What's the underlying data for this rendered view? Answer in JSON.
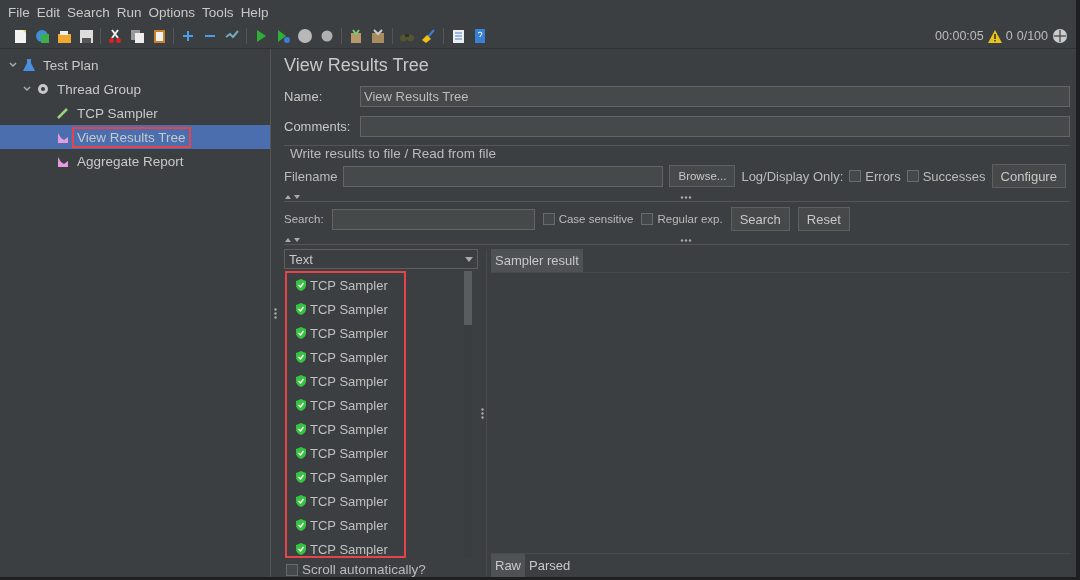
{
  "menu": [
    "File",
    "Edit",
    "Search",
    "Run",
    "Options",
    "Tools",
    "Help"
  ],
  "status": {
    "time": "00:00:05",
    "warnings": "0",
    "threads": "0/100"
  },
  "tree": [
    {
      "label": "Test Plan",
      "kind": "plan",
      "expanded": true,
      "selected": false,
      "highlighted": false,
      "children": [
        {
          "label": "Thread Group",
          "kind": "group",
          "expanded": true,
          "selected": false,
          "highlighted": false,
          "children": [
            {
              "label": "TCP Sampler",
              "kind": "sampler",
              "selected": false,
              "highlighted": false
            },
            {
              "label": "View Results Tree",
              "kind": "listener",
              "selected": true,
              "highlighted": true
            },
            {
              "label": "Aggregate Report",
              "kind": "listener",
              "selected": false,
              "highlighted": false
            }
          ]
        }
      ]
    }
  ],
  "panel": {
    "title": "View Results Tree",
    "name_label": "Name:",
    "name_value": "View Results Tree",
    "comments_label": "Comments:",
    "file_section": {
      "legend": "Write results to file / Read from file",
      "filename_label": "Filename",
      "browse": "Browse...",
      "log_label": "Log/Display Only:",
      "options": [
        {
          "label": "Errors",
          "checked": false
        },
        {
          "label": "Successes",
          "checked": false
        }
      ],
      "configure": "Configure"
    },
    "search": {
      "label": "Search:",
      "options": [
        {
          "label": "Case sensitive",
          "checked": false
        },
        {
          "label": "Regular exp.",
          "checked": false
        }
      ],
      "search_button": "Search",
      "reset_button": "Reset"
    },
    "renderer": "Text",
    "results_highlighted": true,
    "results": [
      {
        "label": "TCP Sampler",
        "success": true
      },
      {
        "label": "TCP Sampler",
        "success": true
      },
      {
        "label": "TCP Sampler",
        "success": true
      },
      {
        "label": "TCP Sampler",
        "success": true
      },
      {
        "label": "TCP Sampler",
        "success": true
      },
      {
        "label": "TCP Sampler",
        "success": true
      },
      {
        "label": "TCP Sampler",
        "success": true
      },
      {
        "label": "TCP Sampler",
        "success": true
      },
      {
        "label": "TCP Sampler",
        "success": true
      },
      {
        "label": "TCP Sampler",
        "success": true
      },
      {
        "label": "TCP Sampler",
        "success": true
      },
      {
        "label": "TCP Sampler",
        "success": true
      }
    ],
    "scroll_auto": {
      "label": "Scroll automatically?",
      "checked": false
    },
    "result_tabs": [
      {
        "label": "Sampler result",
        "selected": true
      }
    ],
    "view_tabs": [
      {
        "label": "Raw",
        "selected": true
      },
      {
        "label": "Parsed",
        "selected": false
      }
    ]
  }
}
